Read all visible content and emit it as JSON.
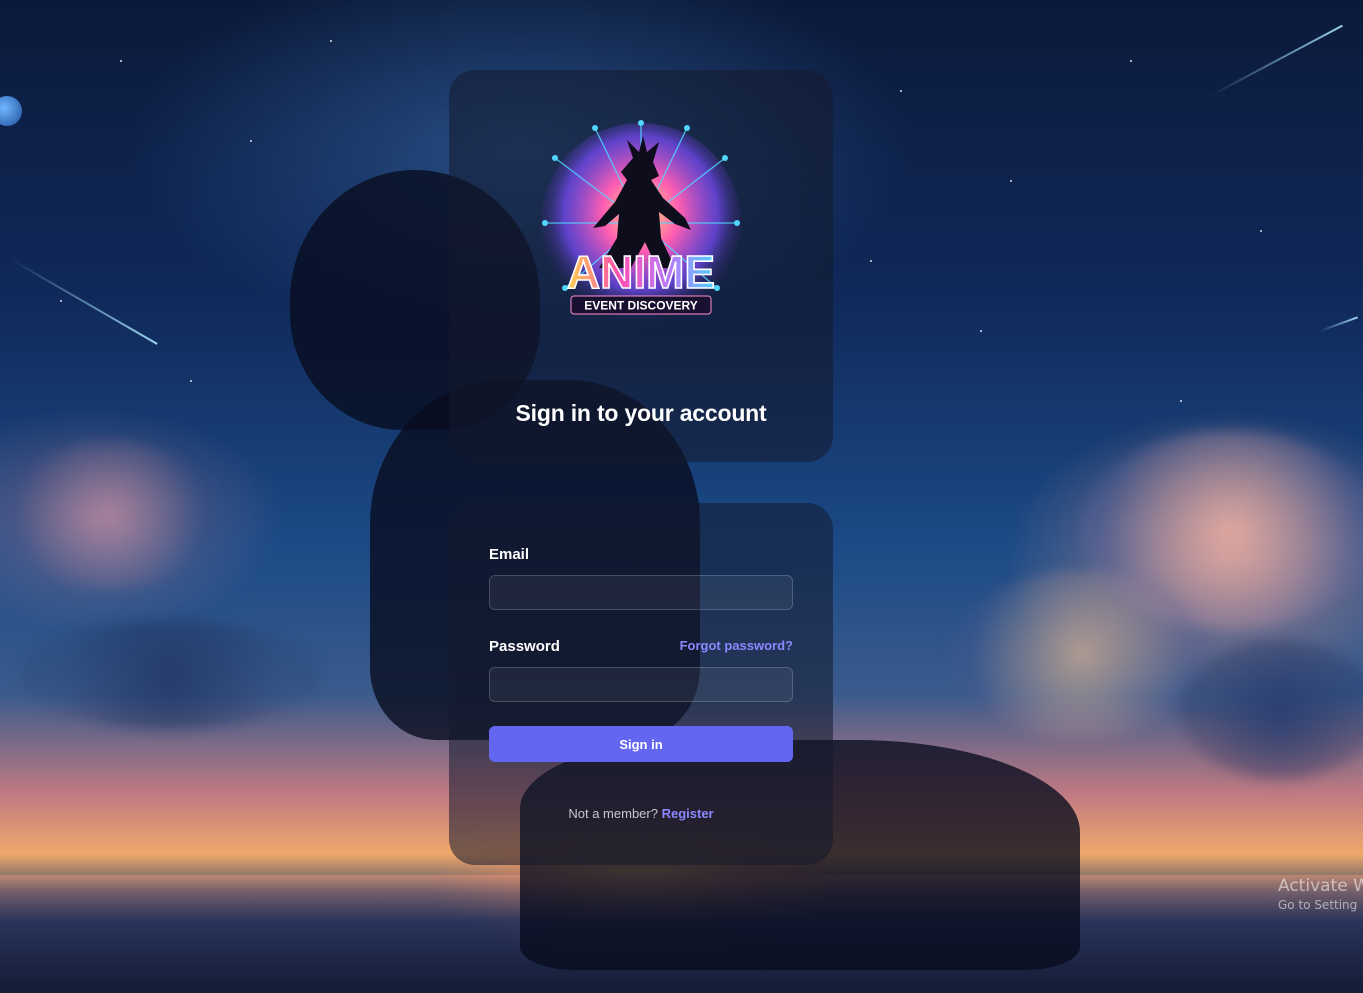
{
  "app": {
    "title": "Sign in to your account",
    "logo": {
      "name": "anime-event-discovery-logo",
      "main_text": "ANIME",
      "sub_text": "EVENT DISCOVERY"
    }
  },
  "form": {
    "email_label": "Email",
    "email_value": "",
    "password_label": "Password",
    "password_value": "",
    "forgot_label": "Forgot password?",
    "submit_label": "Sign in",
    "member_prompt": "Not a member?",
    "register_label": "Register"
  },
  "watermark": {
    "line1": "Activate W",
    "line2": "Go to Setting"
  },
  "colors": {
    "accent": "#6366f1",
    "link": "#8b88ff",
    "card_bg": "rgba(20,26,46,0.55)"
  }
}
